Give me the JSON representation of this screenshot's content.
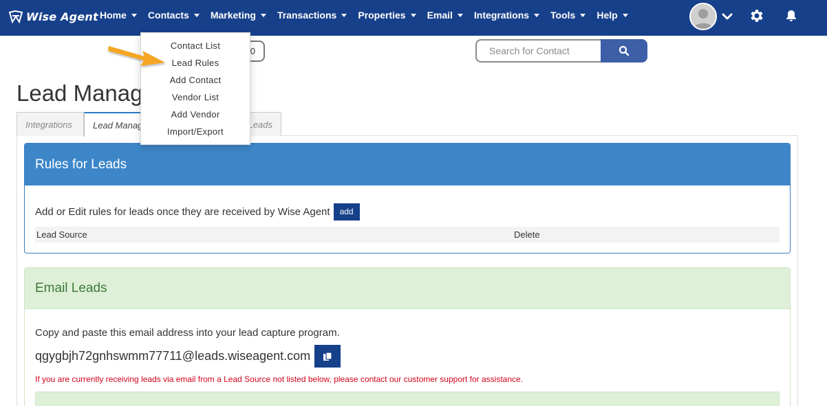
{
  "brand": {
    "name": "Wise Agent"
  },
  "nav": {
    "items": [
      {
        "label": "Home"
      },
      {
        "label": "Contacts"
      },
      {
        "label": "Marketing"
      },
      {
        "label": "Transactions"
      },
      {
        "label": "Properties"
      },
      {
        "label": "Email"
      },
      {
        "label": "Integrations"
      },
      {
        "label": "Tools"
      },
      {
        "label": "Help"
      }
    ]
  },
  "search": {
    "placeholder": "Search for Contact"
  },
  "hidden_pill": {
    "text": "0"
  },
  "page": {
    "title": "Lead Manag"
  },
  "tabs": [
    {
      "label": "Integrations"
    },
    {
      "label": "Lead Manag"
    },
    {
      "label": "Leads"
    }
  ],
  "dropdown": {
    "items": [
      {
        "label": "Contact List"
      },
      {
        "label": "Lead Rules"
      },
      {
        "label": "Add Contact"
      },
      {
        "label": "Vendor List"
      },
      {
        "label": "Add Vendor"
      },
      {
        "label": "Import/Export"
      }
    ]
  },
  "rules_panel": {
    "title": "Rules for Leads",
    "description": "Add or Edit rules for leads once they are received by Wise Agent",
    "add_label": "add",
    "columns": [
      "Lead Source",
      "Delete"
    ]
  },
  "email_panel": {
    "title": "Email Leads",
    "instruction": "Copy and paste this email address into your lead capture program.",
    "email": "qgygbjh72gnhswmm77711@leads.wiseagent.com",
    "warning": "If you are currently receiving leads via email from a Lead Source not listed below, please contact our customer support for assistance."
  },
  "colors": {
    "navbar": "#17408b",
    "panel_blue": "#3d87c9",
    "panel_green_bg": "#dff0d8",
    "warning": "#d0021b",
    "arrow": "#f5a623"
  }
}
